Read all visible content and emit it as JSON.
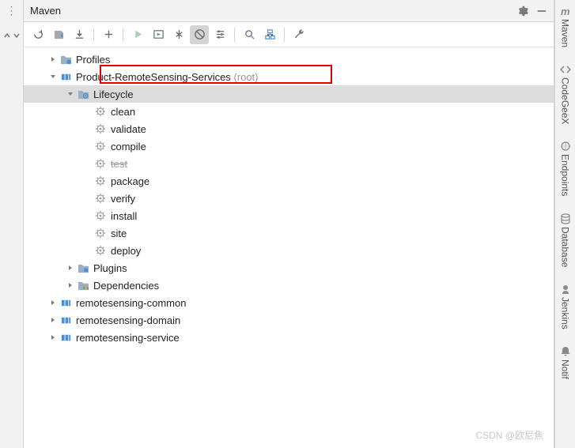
{
  "panel": {
    "title": "Maven"
  },
  "colors": {
    "highlight_border": "#e20000"
  },
  "tree": {
    "profiles": {
      "label": "Profiles"
    },
    "root_project": {
      "name": "Product-RemoteSensing-Services",
      "suffix": "(root)",
      "highlighted": true
    },
    "lifecycle": {
      "label": "Lifecycle",
      "selected": true,
      "phases": [
        {
          "label": "clean",
          "skipped": false
        },
        {
          "label": "validate",
          "skipped": false
        },
        {
          "label": "compile",
          "skipped": false
        },
        {
          "label": "test",
          "skipped": true
        },
        {
          "label": "package",
          "skipped": false
        },
        {
          "label": "verify",
          "skipped": false
        },
        {
          "label": "install",
          "skipped": false
        },
        {
          "label": "site",
          "skipped": false
        },
        {
          "label": "deploy",
          "skipped": false
        }
      ]
    },
    "plugins": {
      "label": "Plugins"
    },
    "dependencies": {
      "label": "Dependencies"
    },
    "modules": [
      {
        "label": "remotesensing-common"
      },
      {
        "label": "remotesensing-domain"
      },
      {
        "label": "remotesensing-service"
      }
    ]
  },
  "right_tabs": [
    {
      "label": "Maven",
      "icon": "maven"
    },
    {
      "label": "CodeGeeX",
      "icon": "codegeex"
    },
    {
      "label": "Endpoints",
      "icon": "endpoints"
    },
    {
      "label": "Database",
      "icon": "database"
    },
    {
      "label": "Jenkins",
      "icon": "jenkins"
    },
    {
      "label": "Notif",
      "icon": "bell"
    }
  ],
  "watermark": "CSDN @欧尼焦"
}
